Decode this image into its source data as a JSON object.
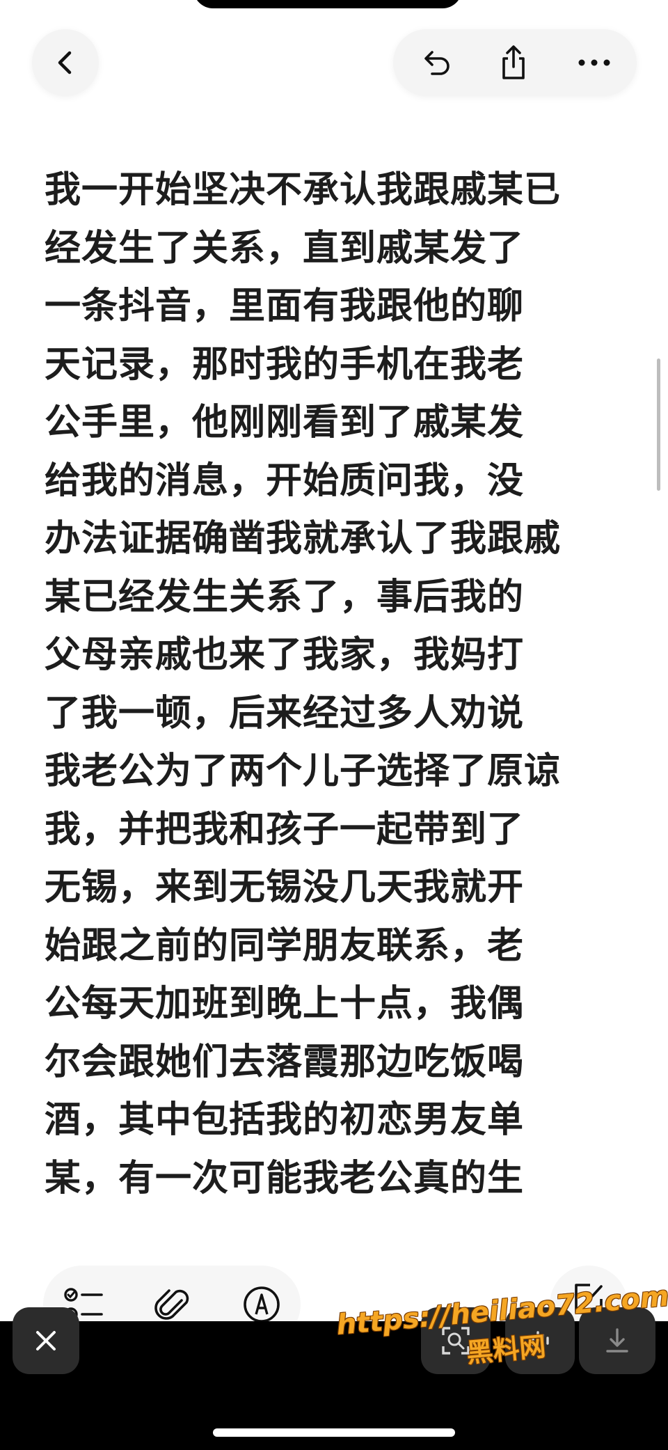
{
  "top_bar": {
    "icons": [
      "back-icon",
      "undo-icon",
      "share-icon",
      "more-icon"
    ]
  },
  "note": {
    "lines": [
      "我一开始坚决不承认我跟戚某已",
      "经发生了关系，直到戚某发了",
      "一条抖音，里面有我跟他的聊",
      "天记录，那时我的手机在我老",
      "公手里，他刚刚看到了戚某发",
      "给我的消息，开始质问我，没",
      "办法证据确凿我就承认了我跟戚",
      "某已经发生关系了，事后我的",
      "父母亲戚也来了我家，我妈打",
      "了我一顿，后来经过多人劝说",
      "我老公为了两个儿子选择了原谅",
      "我，并把我和孩子一起带到了",
      "无锡，来到无锡没几天我就开",
      "始跟之前的同学朋友联系，老",
      "公每天加班到晚上十点，我偶",
      "尔会跟她们去落霞那边吃饭喝",
      "酒，其中包括我的初恋男友单",
      "某，有一次可能我老公真的生"
    ]
  },
  "toolbar": {
    "icons": [
      "checklist-icon",
      "attachment-icon",
      "markup-icon",
      "compose-icon"
    ]
  },
  "bottom_bar": {
    "icons": [
      "close-icon",
      "scan-icon",
      "audio-icon",
      "download-icon"
    ]
  },
  "watermark": {
    "url": "https://heiliao72.com",
    "name": "黑料网"
  },
  "colors": {
    "text": "#1d1d1d",
    "background": "#ffffff",
    "watermark": "#f5a623"
  }
}
